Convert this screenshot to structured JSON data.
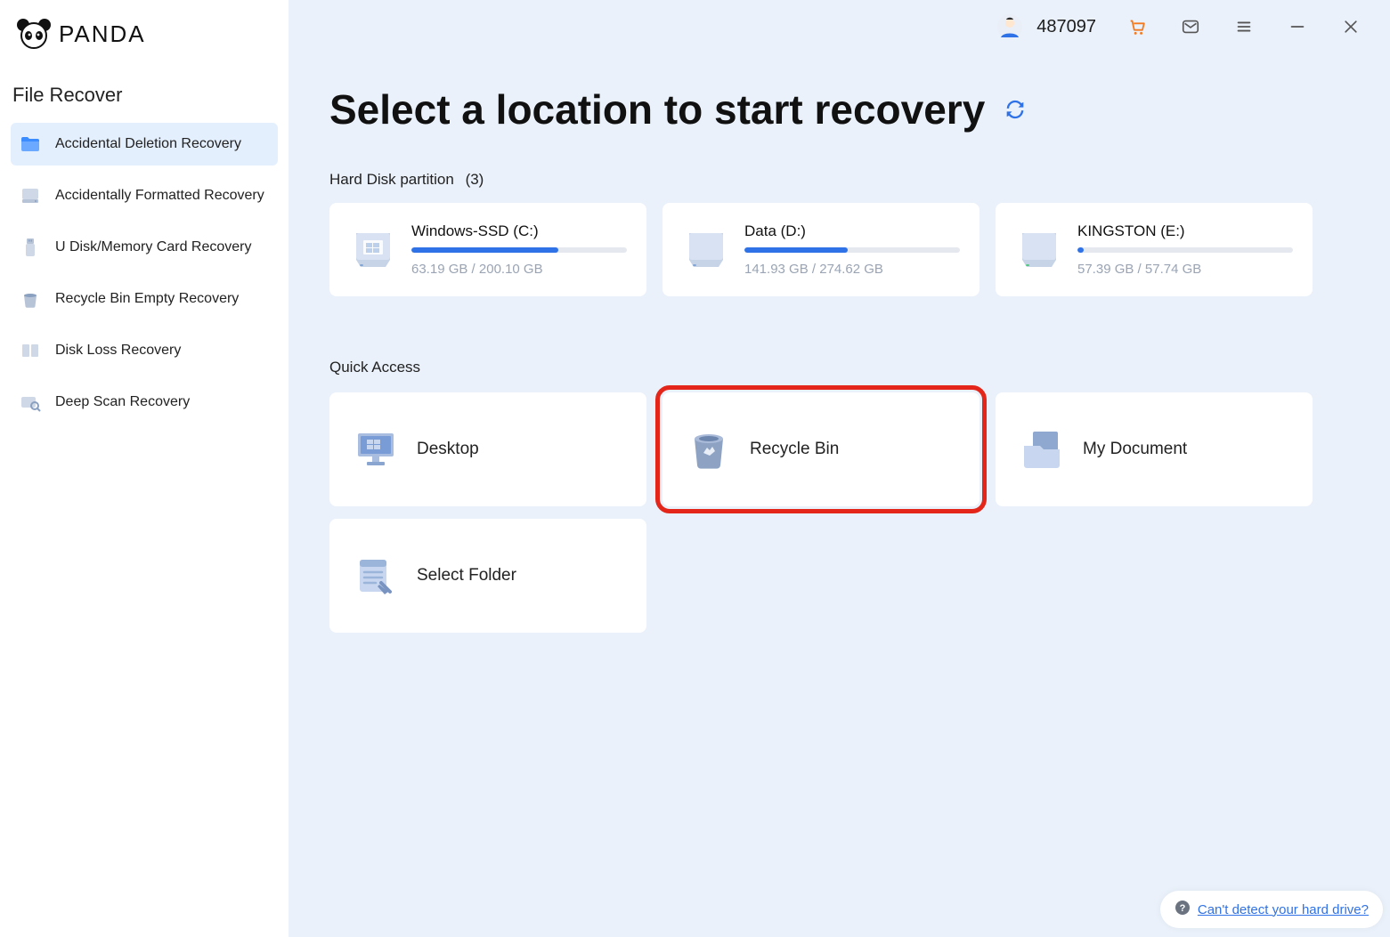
{
  "brand": {
    "name": "PANDA"
  },
  "sidebar": {
    "title": "File Recover",
    "items": [
      {
        "label": "Accidental Deletion Recovery"
      },
      {
        "label": "Accidentally Formatted Recovery"
      },
      {
        "label": "U Disk/Memory Card Recovery"
      },
      {
        "label": "Recycle Bin Empty Recovery"
      },
      {
        "label": "Disk Loss Recovery"
      },
      {
        "label": "Deep Scan Recovery"
      }
    ]
  },
  "header": {
    "user_id": "487097"
  },
  "main": {
    "title": "Select a location to start recovery",
    "disks": {
      "label": "Hard Disk partition",
      "count": "(3)",
      "items": [
        {
          "name": "Windows-SSD   (C:)",
          "size": "63.19 GB / 200.10 GB",
          "fill_pct": 68
        },
        {
          "name": "Data   (D:)",
          "size": "141.93 GB / 274.62 GB",
          "fill_pct": 48
        },
        {
          "name": "KINGSTON   (E:)",
          "size": "57.39 GB / 57.74 GB",
          "fill_pct": 3
        }
      ]
    },
    "quick": {
      "label": "Quick Access",
      "items": [
        {
          "label": "Desktop"
        },
        {
          "label": "Recycle Bin"
        },
        {
          "label": "My Document"
        },
        {
          "label": "Select Folder"
        }
      ]
    }
  },
  "help": {
    "text": "Can't detect your hard drive?"
  }
}
